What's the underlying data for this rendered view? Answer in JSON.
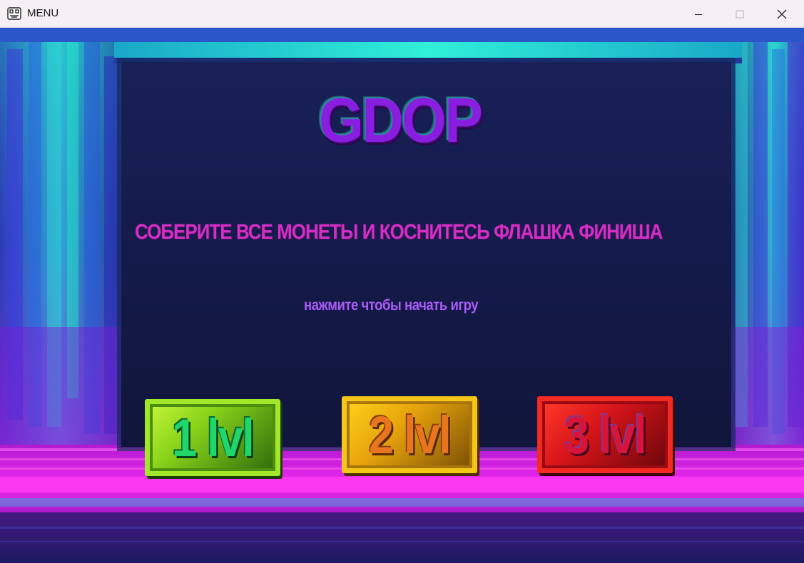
{
  "window": {
    "title": "MENU",
    "app_icon": "game-controller-icon",
    "controls": [
      "minimize-icon",
      "maximize-icon",
      "close-icon"
    ]
  },
  "game": {
    "title": "GDOP",
    "instruction": "СОБЕРИТЕ ВСЕ МОНЕТЫ И КОСНИТЕСЬ ФЛАШКА ФИНИША",
    "start_hint": "нажмите чтобы начать игру",
    "levels": [
      {
        "label": "1 lvl",
        "color": "#8ad41a"
      },
      {
        "label": "2 lvl",
        "color": "#e6a30c"
      },
      {
        "label": "3 lvl",
        "color": "#d8151a"
      }
    ]
  },
  "colors": {
    "title": "#8a1ee0",
    "instruction": "#d22fc4",
    "start_hint": "#a35ef2",
    "floor_glow": "#e21ee8",
    "frame_cyan": "#2ee6d6"
  }
}
